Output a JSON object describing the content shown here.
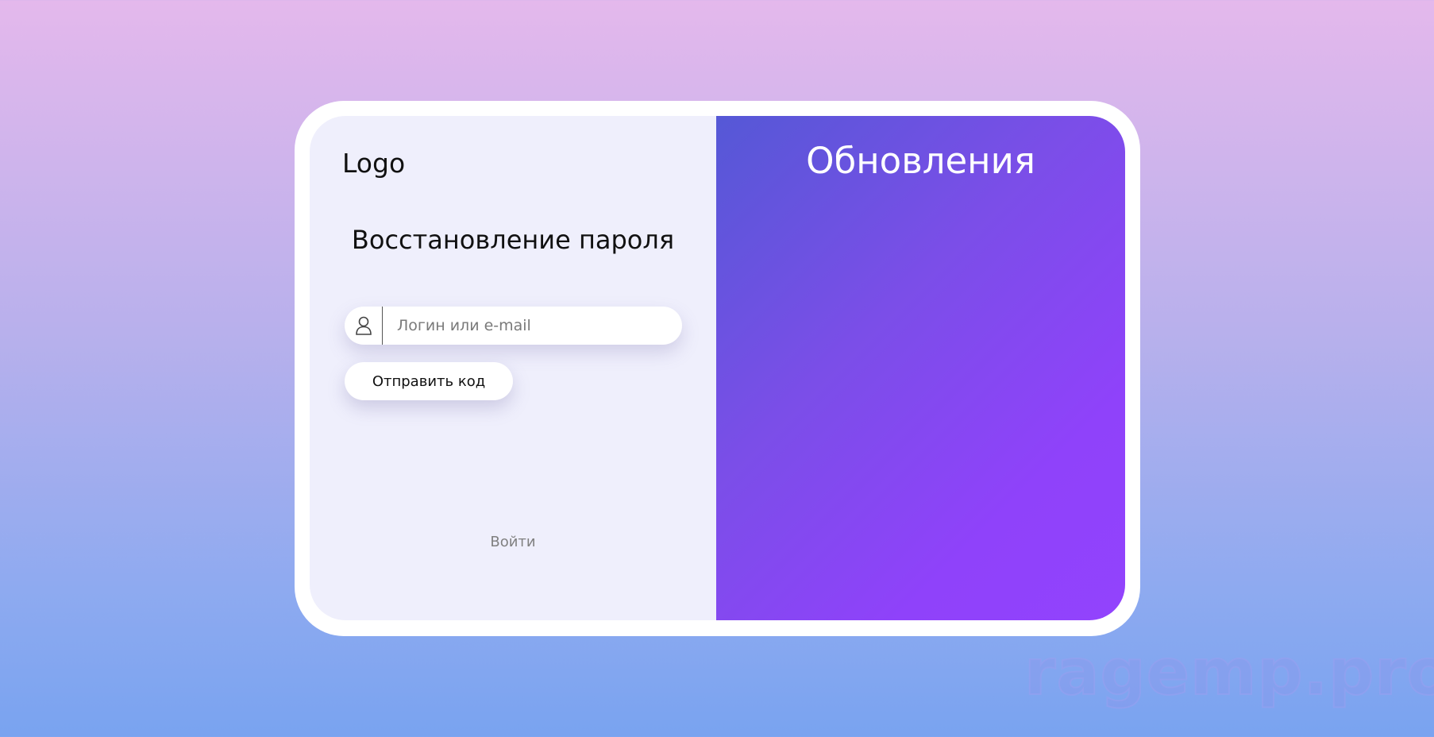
{
  "left_panel": {
    "logo": "Logo",
    "title": "Восстановление пароля",
    "login_field": {
      "placeholder": "Логин или e-mail",
      "value": "",
      "icon": "user-icon"
    },
    "send_button_label": "Отправить код",
    "signin_link": "Войти"
  },
  "right_panel": {
    "title": "Обновления"
  },
  "watermark": "ragemp.pro",
  "colors": {
    "accent_start": "#5558d6",
    "accent_end": "#9243fd",
    "left_bg": "#efeffc",
    "frame": "#ffffff"
  }
}
